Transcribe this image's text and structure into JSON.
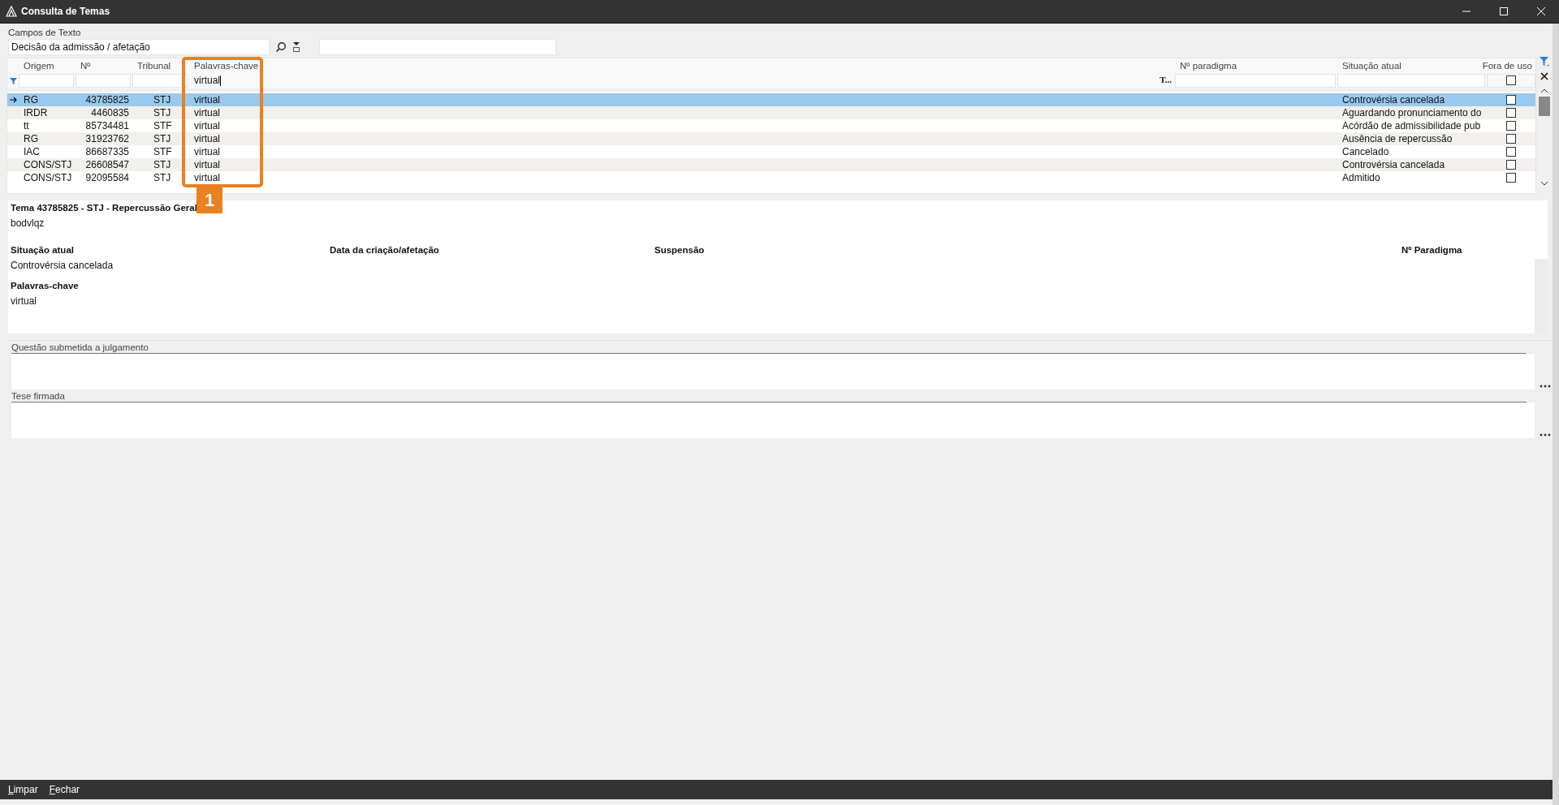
{
  "window": {
    "title": "Consulta de Temas"
  },
  "text_search": {
    "label": "Campos de Texto",
    "value": "Decisão da admissão / afetação"
  },
  "grid": {
    "columns": [
      {
        "label": "Origem"
      },
      {
        "label": "Nº"
      },
      {
        "label": "Tribunal"
      },
      {
        "label": "Palavras-chave",
        "filter": "virtual",
        "focused": true
      },
      {
        "label": "Nº paradigma"
      },
      {
        "label": "Situação atual"
      },
      {
        "label": "Fora de uso",
        "filter_checked": false
      }
    ],
    "truncated_filter_text": "T...",
    "rows": [
      {
        "selected": true,
        "origem": "RG",
        "numero": "43785825",
        "tribunal": "STJ",
        "palavras": "virtual",
        "situacao": "Controvérsia cancelada",
        "fora_de_uso": false
      },
      {
        "selected": false,
        "origem": "IRDR",
        "numero": "4460835",
        "tribunal": "STJ",
        "palavras": "virtual",
        "situacao": "Aguardando pronunciamento do",
        "fora_de_uso": false
      },
      {
        "selected": false,
        "origem": "tt",
        "numero": "85734481",
        "tribunal": "STF",
        "palavras": "virtual",
        "situacao": "Acórdão de admissibilidade pub",
        "fora_de_uso": false
      },
      {
        "selected": false,
        "origem": "RG",
        "numero": "31923762",
        "tribunal": "STJ",
        "palavras": "virtual",
        "situacao": "Ausência de repercussão",
        "fora_de_uso": false
      },
      {
        "selected": false,
        "origem": "IAC",
        "numero": "86687335",
        "tribunal": "STF",
        "palavras": "virtual",
        "situacao": "Cancelado",
        "fora_de_uso": false
      },
      {
        "selected": false,
        "origem": "CONS/STJ",
        "numero": "26608547",
        "tribunal": "STJ",
        "palavras": "virtual",
        "situacao": "Controvérsia cancelada",
        "fora_de_uso": false
      },
      {
        "selected": false,
        "origem": "CONS/STJ",
        "numero": "92095584",
        "tribunal": "STJ",
        "palavras": "virtual",
        "situacao": "Admitido",
        "fora_de_uso": false
      }
    ]
  },
  "details": {
    "title": "Tema 43785825 - STJ - Repercussão Geral",
    "subtitle": "bodvlqz",
    "fields": [
      {
        "label": "Situação atual",
        "value": "Controvérsia cancelada"
      },
      {
        "label": "Data da criação/afetação"
      },
      {
        "label": "Suspensão"
      },
      {
        "label": "Nº Paradigma"
      }
    ],
    "keywords": {
      "label": "Palavras-chave",
      "value": "virtual"
    }
  },
  "text_sections": [
    {
      "label": "Questão submetida a julgamento"
    },
    {
      "label": "Tese firmada"
    }
  ],
  "callout": {
    "number": "1"
  },
  "buttons": [
    {
      "label": "Limpar"
    },
    {
      "label": "Fechar"
    }
  ]
}
